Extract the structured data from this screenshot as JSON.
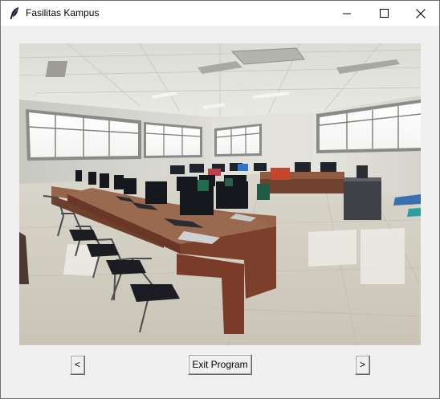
{
  "window": {
    "title": "Fasilitas Kampus",
    "icon": "feather-icon",
    "controls": [
      "minimize-icon",
      "maximize-icon",
      "close-icon"
    ]
  },
  "image": {
    "subject": "computer-lab-photo"
  },
  "buttons": {
    "prev_label": "<",
    "exit_label": "Exit Program",
    "next_label": ">"
  }
}
